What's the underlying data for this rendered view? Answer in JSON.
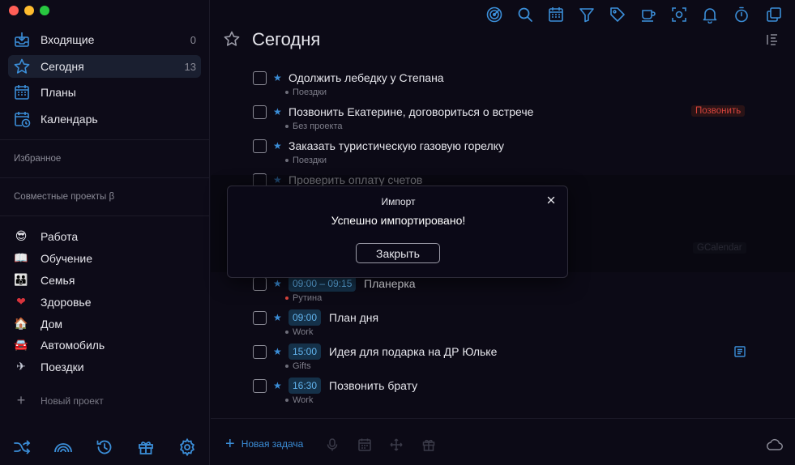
{
  "sidebar": {
    "nav": [
      {
        "label": "Входящие",
        "count": "0",
        "icon": "inbox-icon"
      },
      {
        "label": "Сегодня",
        "count": "13",
        "icon": "star-icon"
      },
      {
        "label": "Планы",
        "count": "",
        "icon": "calendar-grid-icon"
      },
      {
        "label": "Календарь",
        "count": "",
        "icon": "calendar-clock-icon"
      }
    ],
    "favorites_label": "Избранное",
    "shared_label": "Совместные проекты β",
    "projects": [
      {
        "emoji": "😎",
        "label": "Работа"
      },
      {
        "emoji": "📖",
        "label": "Обучение"
      },
      {
        "emoji": "👪",
        "label": "Семья"
      },
      {
        "emoji": "❤",
        "label": "Здоровье"
      },
      {
        "emoji": "🏠",
        "label": "Дом"
      },
      {
        "emoji": "🚘",
        "label": "Автомобиль"
      },
      {
        "emoji": "✈",
        "label": "Поездки"
      }
    ],
    "new_project_label": "Новый проект",
    "bottom_icons": [
      "shuffle-icon",
      "rainbow-icon",
      "history-icon",
      "gift-icon",
      "gear-icon"
    ]
  },
  "toolbar": {
    "icons": [
      "radar-icon",
      "search-icon",
      "calendar-icon",
      "filter-icon",
      "tag-icon",
      "mug-icon",
      "focus-icon",
      "bell-icon",
      "timer-icon",
      "copy-icon"
    ]
  },
  "page": {
    "title": "Сегодня",
    "view_toggle_icon": "list-view-icon"
  },
  "tasks": [
    {
      "title": "Одолжить лебедку у Степана",
      "project": "Поездки"
    },
    {
      "title": "Позвонить Екатерине, договориться о встрече",
      "project": "Без проекта",
      "tag": "Позвонить"
    },
    {
      "title": "Заказать туристическую газовую горелку",
      "project": "Поездки"
    },
    {
      "title": "Проверить оплату счетов",
      "project": ""
    },
    {
      "time": "09:00 – 09:15",
      "title": "Планерка",
      "project": "Рутина"
    },
    {
      "time": "09:00",
      "title": "План дня",
      "project": "Work"
    },
    {
      "time": "15:00",
      "title": "Идея для подарка на ДР Юльке",
      "project": "Gifts"
    },
    {
      "time": "16:30",
      "title": "Позвонить брату",
      "project": "Work"
    }
  ],
  "hidden_tag": "GCalendar",
  "footer": {
    "new_task_label": "Новая задача",
    "icons": [
      "microphone-icon",
      "calendar-icon",
      "move-icon",
      "gift-icon"
    ],
    "sync_icon": "cloud-icon"
  },
  "modal": {
    "title": "Импорт",
    "message": "Успешно импортировано!",
    "button_label": "Закрыть"
  },
  "colors": {
    "background": "#0c0a16",
    "accent": "#3b8ed8",
    "time_badge_bg": "#153149",
    "call_tag": "#d8443c"
  }
}
